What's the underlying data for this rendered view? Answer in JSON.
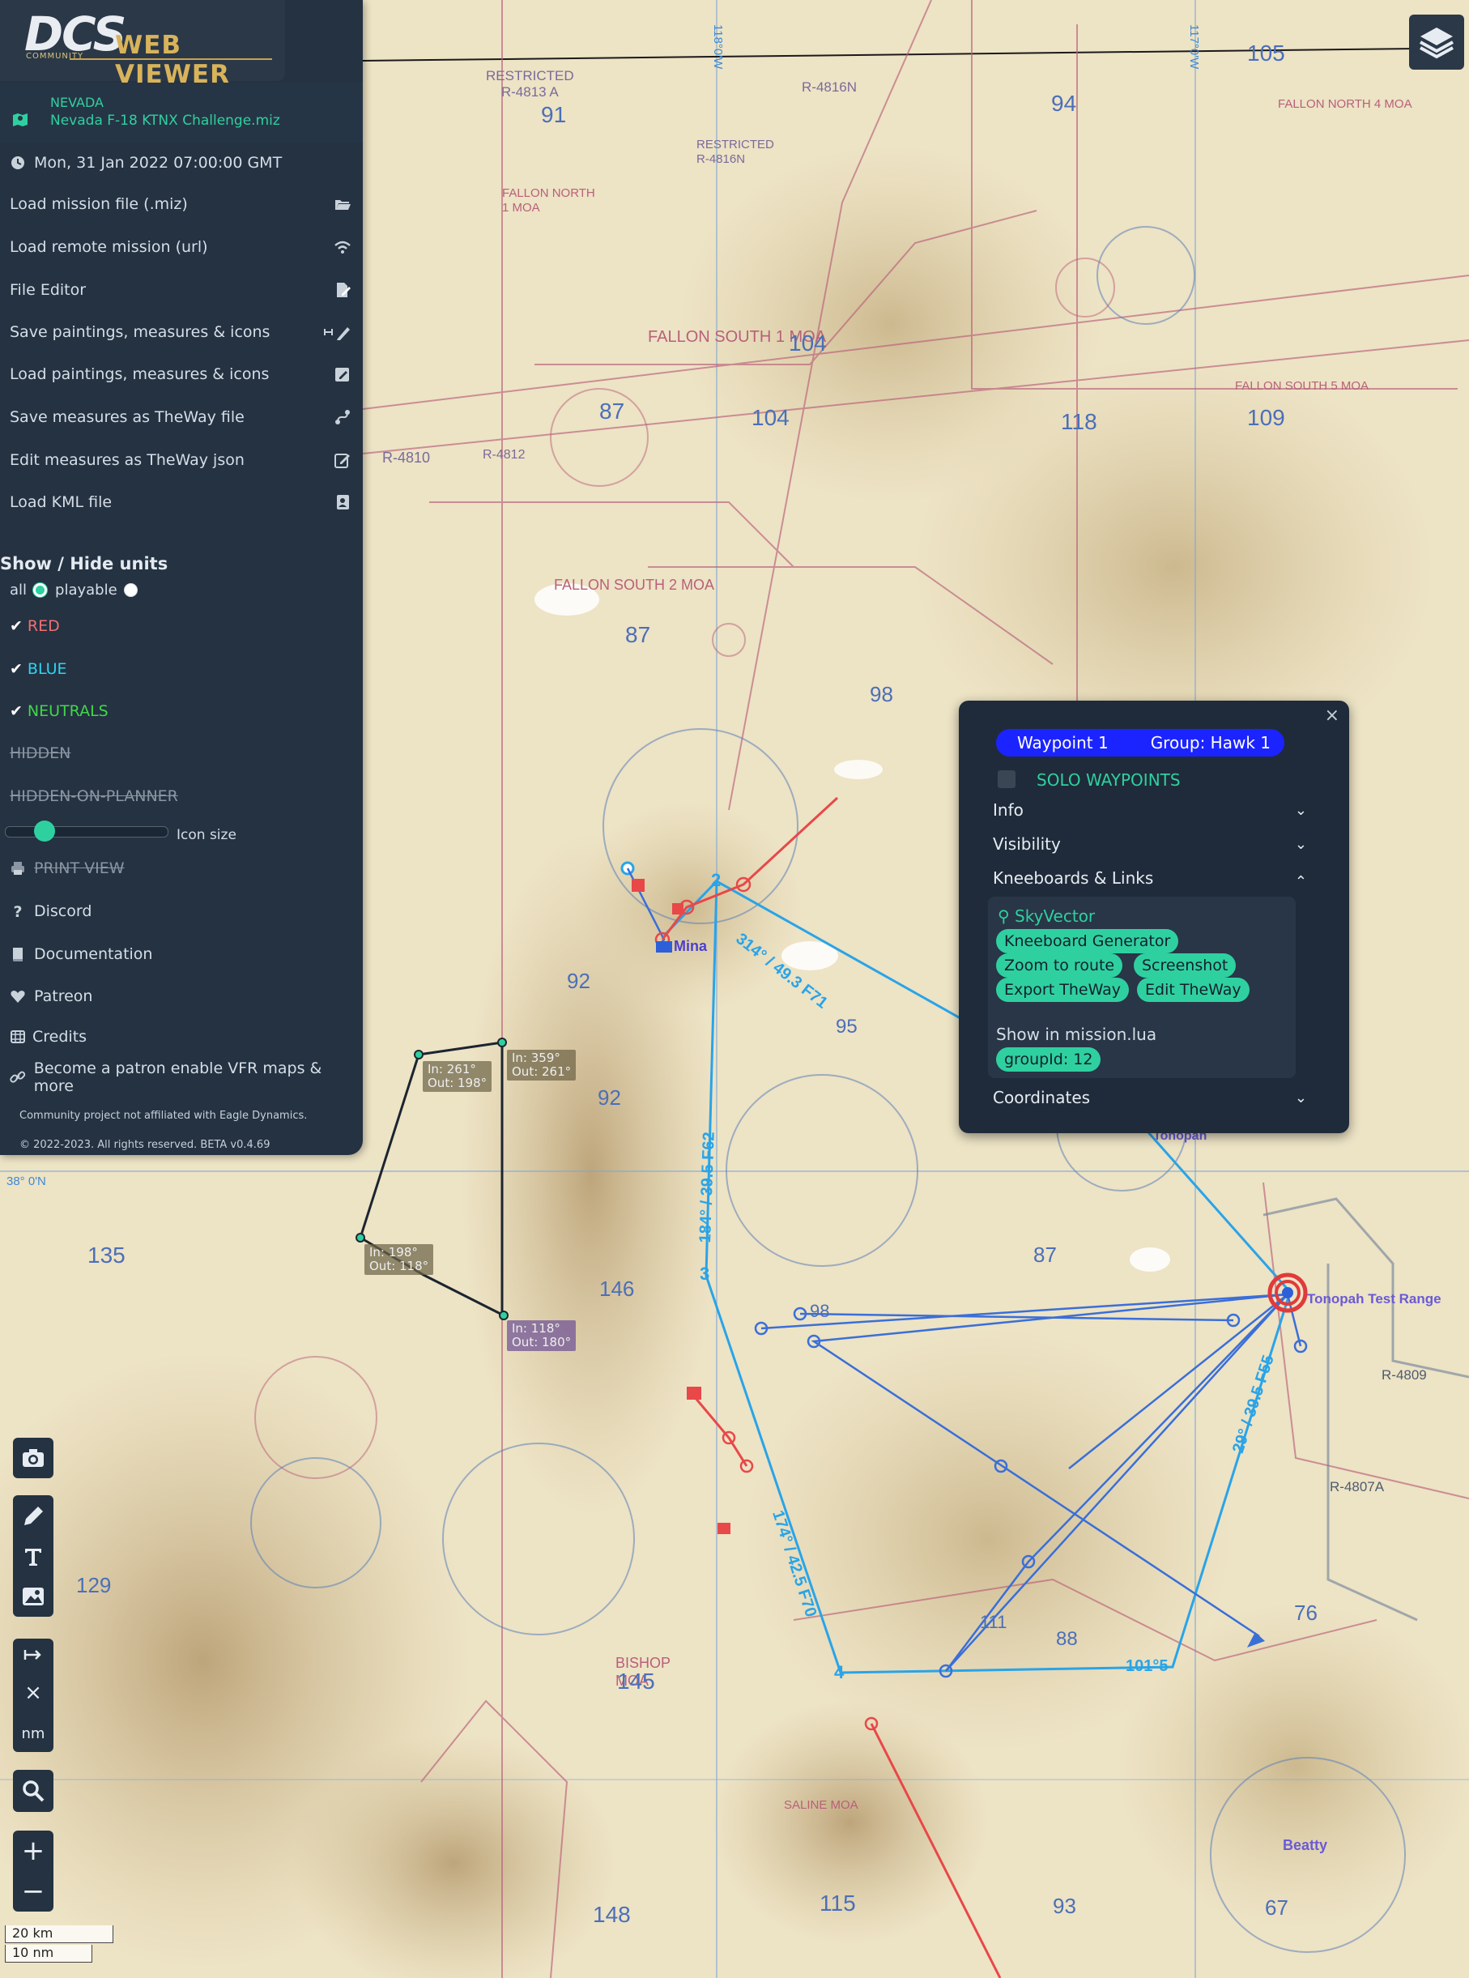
{
  "app": {
    "logo_main": "DCS",
    "logo_community": "COMMUNITY",
    "logo_suffix": "WEB VIEWER"
  },
  "mission": {
    "region": "NEVADA",
    "file": "Nevada F-18 KTNX Challenge.miz",
    "datetime": "Mon, 31 Jan 2022 07:00:00 GMT"
  },
  "menu": {
    "load_mission": "Load mission file (.miz)",
    "load_remote": "Load remote mission (url)",
    "file_editor": "File Editor",
    "save_paintings": "Save paintings, measures & icons",
    "load_paintings": "Load paintings, measures & icons",
    "save_theway": "Save measures as TheWay file",
    "edit_theway": "Edit measures as TheWay json",
    "load_kml": "Load KML file"
  },
  "units": {
    "title": "Show / Hide units",
    "all_label": "all",
    "playable_label": "playable",
    "red": "RED",
    "blue": "BLUE",
    "neutrals": "NEUTRALS",
    "hidden": "HIDDEN",
    "hidden_on_planner": "HIDDEN-ON-PLANNER",
    "icon_size_label": "Icon size",
    "icon_size_value": 0.2
  },
  "links": {
    "print_view": "PRINT VIEW",
    "discord": "Discord",
    "documentation": "Documentation",
    "patreon": "Patreon",
    "credits": "Credits",
    "become_patron": "Become a patron enable VFR maps & more"
  },
  "footer": {
    "disclaimer": "Community project not affiliated with Eagle Dynamics.",
    "copyright": "© 2022-2023. All rights reserved. BETA v0.4.69"
  },
  "popup": {
    "close": "×",
    "waypoint": "Waypoint 1",
    "group": "Group: Hawk 1",
    "solo": "SOLO WAYPOINTS",
    "sections": {
      "info": "Info",
      "visibility": "Visibility",
      "kneeboards": "Kneeboards & Links",
      "coordinates": "Coordinates"
    },
    "links": {
      "skyvector": "SkyVector",
      "kneeboard_generator": "Kneeboard Generator",
      "zoom_to_route": "Zoom to route",
      "screenshot": "Screenshot",
      "export_theway": "Export TheWay",
      "edit_theway": "Edit TheWay",
      "show_in_lua": "Show in mission.lua",
      "group_id": "groupId: 12"
    }
  },
  "tools": {
    "units_toggle": "nm",
    "measure_clear": "×",
    "zoom_in": "+",
    "zoom_out": "−"
  },
  "scale": {
    "km": "20 km",
    "nm": "10 nm"
  },
  "map": {
    "labels": {
      "restricted_4813": "RESTRICTED\nR-4813 A",
      "r4816n": "R-4816N",
      "restricted_4816n": "RESTRICTED\nR-4816N",
      "fallon_north_4": "FALLON NORTH 4 MOA",
      "fallon_north_1": "FALLON NORTH\n1 MOA",
      "fallon_south_1": "FALLON SOUTH 1 MOA",
      "fallon_south_2": "FALLON SOUTH 2 MOA",
      "fallon_south_5": "FALLON SOUTH 5 MOA",
      "r4810": "R-4810",
      "r4812": "R-4812",
      "mina": "Mina",
      "tonopah_test_range": "Tonopah Test Range",
      "tonopah": "Tonopah",
      "r4809": "R-4809",
      "r4807a": "R-4807A",
      "beatty": "Beatty",
      "bishop_moa": "BISHOP\nMOA",
      "saline_moa": "SALINE MOA",
      "lon_118": "118°0'W",
      "lon_117": "117°0'W",
      "lat_38": "38° 0'N"
    },
    "elevations": [
      "91",
      "94",
      "105",
      "104",
      "87",
      "104",
      "118",
      "109",
      "87",
      "98",
      "92",
      "95",
      "92",
      "87",
      "98",
      "135",
      "146",
      "145",
      "148",
      "115",
      "93",
      "76",
      "67",
      "129",
      "111",
      "88"
    ],
    "routes": {
      "leg_2_3": "184° / 39.5 F62",
      "leg_1_2": "314° / 49.3 F71",
      "leg_3_4": "174° / 42.5 F70",
      "leg_5_6": "29° / 39.5 F55",
      "leg_4_5": "101°5",
      "wp2": "2",
      "wp3": "3",
      "wp4": "4"
    },
    "route_boxes": [
      {
        "in": "In: 261°",
        "out": "Out: 198°"
      },
      {
        "in": "In: 359°",
        "out": "Out: 261°"
      },
      {
        "in": "In: 198°",
        "out": "Out: 118°"
      },
      {
        "in": "In: 118°",
        "out": "Out: 180°"
      }
    ]
  },
  "colors": {
    "accent": "#2fd0a0",
    "sidebar_bg": "#243242",
    "waypoint_pill": "#1b24ff",
    "red_coalition": "#f05a5a",
    "blue_route": "#29a4e8"
  }
}
